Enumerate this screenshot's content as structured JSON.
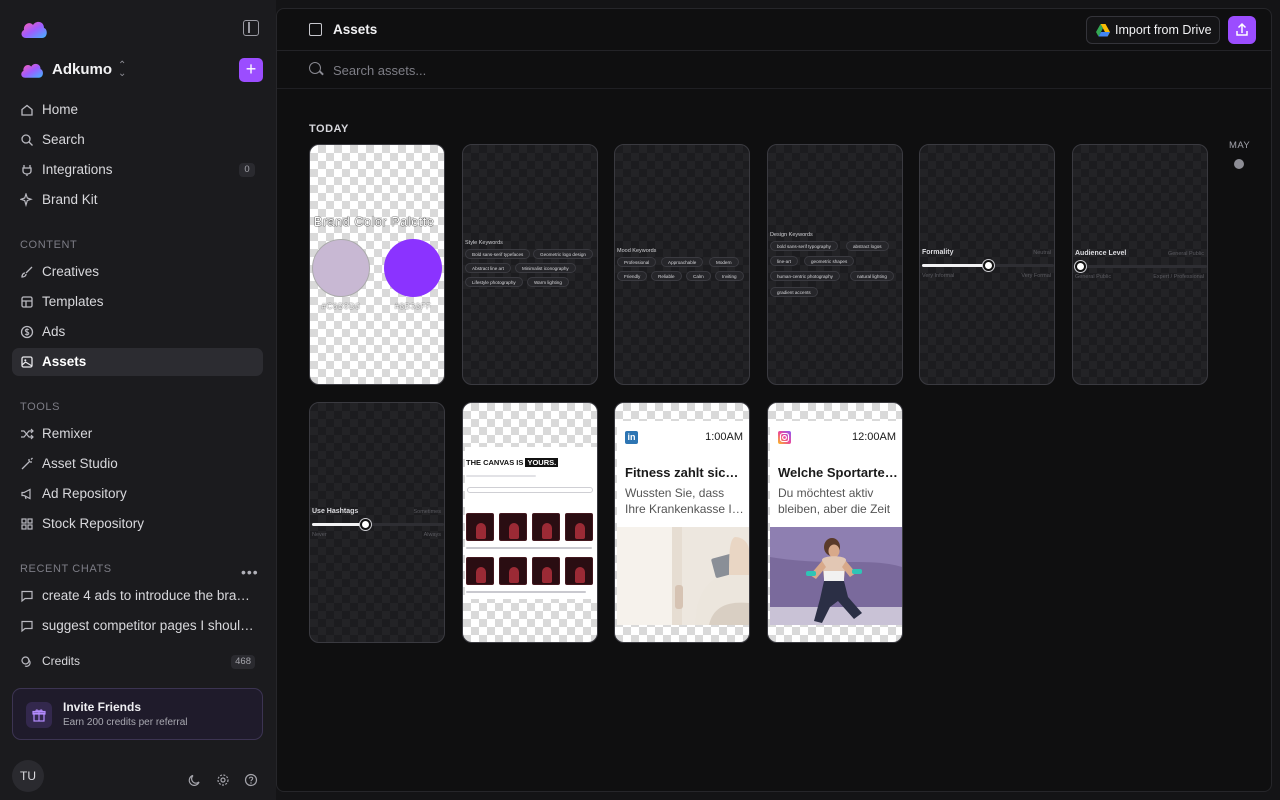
{
  "sidebar": {
    "workspace": "Adkumo",
    "nav": [
      {
        "label": "Home",
        "icon": "home-icon"
      },
      {
        "label": "Search",
        "icon": "search-icon"
      },
      {
        "label": "Integrations",
        "icon": "plug-icon",
        "count": "0"
      },
      {
        "label": "Brand Kit",
        "icon": "sparkle-icon"
      }
    ],
    "content_title": "CONTENT",
    "content": [
      {
        "label": "Creatives",
        "icon": "brush-icon"
      },
      {
        "label": "Templates",
        "icon": "layout-icon"
      },
      {
        "label": "Ads",
        "icon": "dollar-icon"
      },
      {
        "label": "Assets",
        "icon": "image-icon",
        "active": true
      }
    ],
    "tools_title": "TOOLS",
    "tools": [
      {
        "label": "Remixer",
        "icon": "shuffle-icon"
      },
      {
        "label": "Asset Studio",
        "icon": "wand-icon"
      },
      {
        "label": "Ad Repository",
        "icon": "megaphone-icon"
      },
      {
        "label": "Stock Repository",
        "icon": "grid-icon"
      }
    ],
    "recent_title": "RECENT CHATS",
    "recent": [
      {
        "label": "create 4 ads to introduce the brand to new audiences"
      },
      {
        "label": "suggest competitor pages I should follow"
      }
    ],
    "credits": {
      "label": "Credits",
      "count": "468"
    },
    "invite": {
      "title": "Invite Friends",
      "subtitle": "Earn 200 credits per referral"
    },
    "avatar": "TU"
  },
  "header": {
    "title": "Assets",
    "import_label": "Import from Drive"
  },
  "search": {
    "placeholder": "Search assets..."
  },
  "group": {
    "title": "TODAY",
    "month": "MAY"
  },
  "tiles": {
    "palette": {
      "title": "Brand Color Palette",
      "swatches": [
        {
          "hex": "#C8B8D3",
          "label": "#C8B8D3"
        },
        {
          "hex": "#8B33FF",
          "label": "#8B33FF"
        }
      ]
    },
    "style": {
      "title": "Style Keywords",
      "chips": [
        "Bold sans-serif typefaces",
        "Geometric logo design",
        "Abstract line art",
        "Minimalist iconography",
        "Lifestyle photography",
        "Warm lighting"
      ]
    },
    "mood": {
      "title": "Mood Keywords",
      "chips": [
        "Professional",
        "Approachable",
        "Modern",
        "Friendly",
        "Reliable",
        "Calm",
        "Inviting"
      ]
    },
    "design": {
      "title": "Design Keywords",
      "chips": [
        "bold sans-serif typography",
        "abstract logos",
        "line-art",
        "geometric shapes",
        "human-centric photography",
        "natural lighting",
        "gradient accents"
      ]
    },
    "formality": {
      "title": "Formality",
      "value_label": "Neutral",
      "min": "Very Informal",
      "max": "Very Formal",
      "level": 0.5
    },
    "audience": {
      "title": "Audience Level",
      "value_label": "General Public",
      "min": "General Public",
      "max": "Expert / Professional",
      "level": 0.0
    },
    "hashtags": {
      "title": "Use Hashtags",
      "value_label": "Sometimes",
      "min": "Never",
      "max": "Always",
      "level": 0.4
    },
    "canvas": {
      "headline": "THE CANVAS IS",
      "highlight": "YOURS."
    },
    "linkedin": {
      "time": "1:00AM",
      "title": "Fitness zahlt sich aus",
      "body": [
        "Wussten Sie, dass",
        "Ihre Krankenkasse Ihnen"
      ]
    },
    "instagram": {
      "time": "12:00AM",
      "title": "Welche Sportarten passen",
      "body": [
        "Du möchtest aktiv",
        "bleiben, aber die Zeit"
      ]
    }
  },
  "colors": {
    "accent": "#9B4DFF",
    "background": "#0F0F10",
    "sidebar": "#1B1B1E"
  }
}
